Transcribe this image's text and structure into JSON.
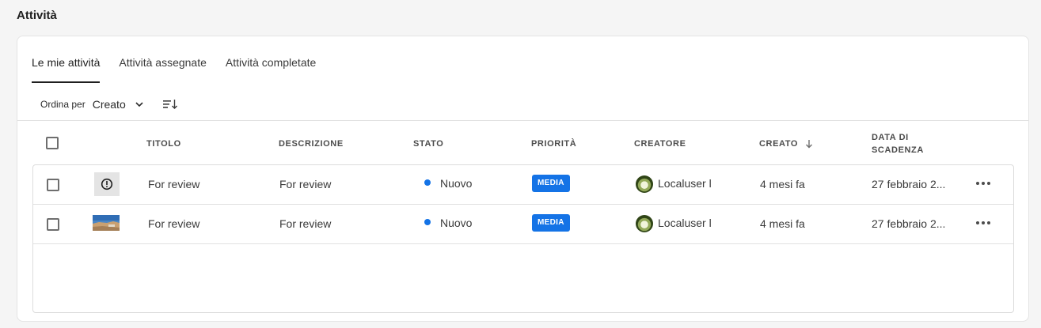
{
  "page": {
    "title": "Attività"
  },
  "tabs": [
    {
      "label": "Le mie attività",
      "selected": true
    },
    {
      "label": "Attività assegnate",
      "selected": false
    },
    {
      "label": "Attività completate",
      "selected": false
    }
  ],
  "sort": {
    "label": "Ordina per",
    "value": "Creato",
    "direction": "descending"
  },
  "table": {
    "columns": [
      "TITOLO",
      "DESCRIZIONE",
      "STATO",
      "PRIORITÀ",
      "CREATORE",
      "CREATO",
      "DATA DI",
      "SCADENZA"
    ],
    "rows": [
      {
        "thumbnail": "alert-icon",
        "title": "For review",
        "description": "For review",
        "status": "Nuovo",
        "status_color": "#1473e6",
        "priority": "MEDIA",
        "priority_color": "#1473e6",
        "creator": "Localuser l",
        "created": "4 mesi fa",
        "due": "27 febbraio 2..."
      },
      {
        "thumbnail": "landscape-image",
        "title": "For review",
        "description": "For review",
        "status": "Nuovo",
        "status_color": "#1473e6",
        "priority": "MEDIA",
        "priority_color": "#1473e6",
        "creator": "Localuser l",
        "created": "4 mesi fa",
        "due": "27 febbraio 2..."
      }
    ]
  }
}
